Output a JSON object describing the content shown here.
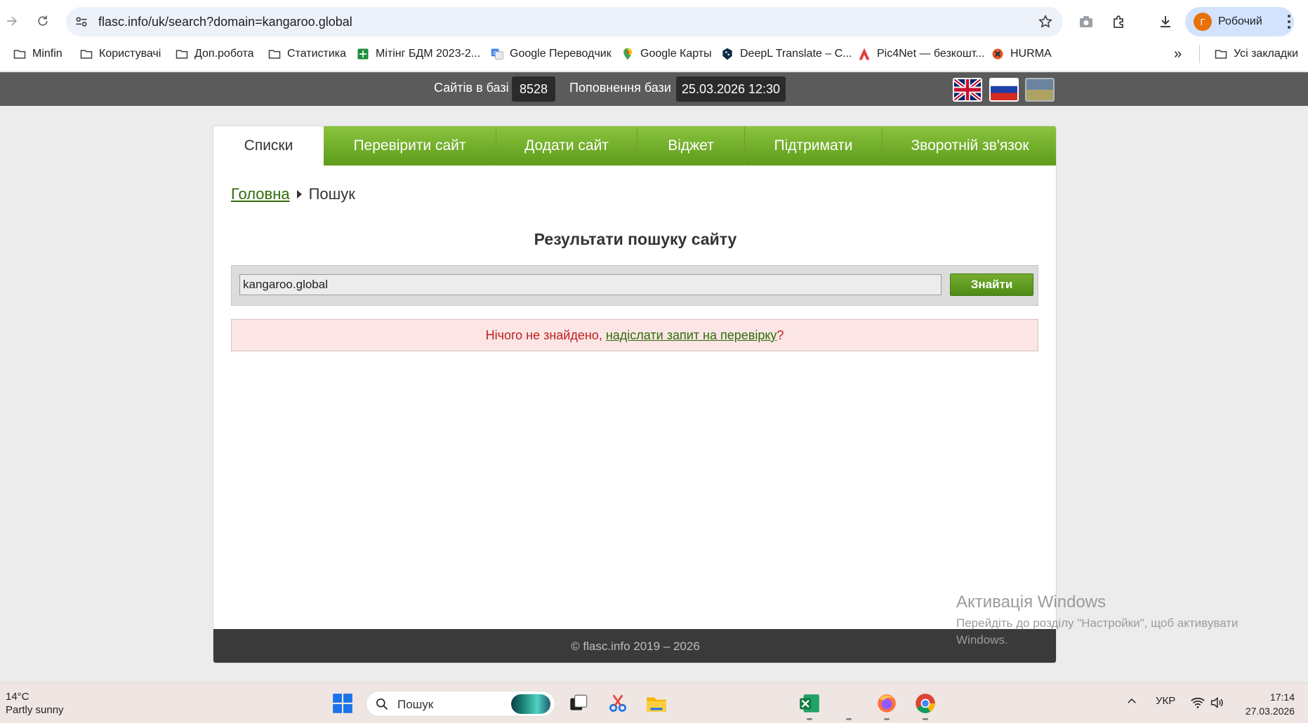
{
  "browser": {
    "url": "flasc.info/uk/search?domain=kangaroo.global",
    "profile_initial": "Г",
    "profile_name": "Робочий"
  },
  "bookmarks": [
    {
      "label": "Minfin",
      "icon": "folder-icon"
    },
    {
      "label": "Користувачі",
      "icon": "folder-icon"
    },
    {
      "label": "Доп.робота",
      "icon": "folder-icon"
    },
    {
      "label": "Статистика",
      "icon": "folder-icon"
    },
    {
      "label": "Мітінг БДМ 2023-2...",
      "icon": "sheets-icon"
    },
    {
      "label": "Google Переводчик",
      "icon": "google-translate-icon"
    },
    {
      "label": "Google Карты",
      "icon": "google-maps-icon"
    },
    {
      "label": "DeepL Translate – С...",
      "icon": "deepl-icon"
    },
    {
      "label": "Pic4Net — безкошт...",
      "icon": "pic4net-icon"
    },
    {
      "label": "HURMA",
      "icon": "hurma-icon"
    }
  ],
  "all_bookmarks_label": "Усі закладки",
  "topbar": {
    "sites_label": "Сайтів в базі",
    "sites_count": "8528",
    "update_label": "Поповнення бази",
    "update_value": "25.03.2026 12:30"
  },
  "tabs": [
    {
      "label": "Списки",
      "active": true
    },
    {
      "label": "Перевірити сайт"
    },
    {
      "label": "Додати сайт"
    },
    {
      "label": "Віджет"
    },
    {
      "label": "Підтримати"
    },
    {
      "label": "Зворотній зв'язок"
    }
  ],
  "breadcrumb": {
    "home": "Головна",
    "current": "Пошук"
  },
  "page_title": "Результати пошуку сайту",
  "search": {
    "value": "kangaroo.global",
    "button": "Знайти"
  },
  "alert": {
    "text": "Нічого не знайдено,",
    "link": "надіслати запит на перевірку",
    "suffix": "?"
  },
  "footer": "© flasc.info 2019 – 2026",
  "watermark": {
    "title": "Активація Windows",
    "text": "Перейдіть до розділу \"Настройки\", щоб активувати Windows."
  },
  "taskbar": {
    "temperature": "14°C",
    "weather": "Partly sunny",
    "search_label": "Пошук",
    "language": "УКР",
    "time": "17:14",
    "date": "27.03.2026"
  },
  "colors": {
    "tab_green": "#6eac27",
    "link_green": "#2f6d09",
    "alert_bg": "#fbe5e5",
    "alert_text": "#c01f1f"
  }
}
